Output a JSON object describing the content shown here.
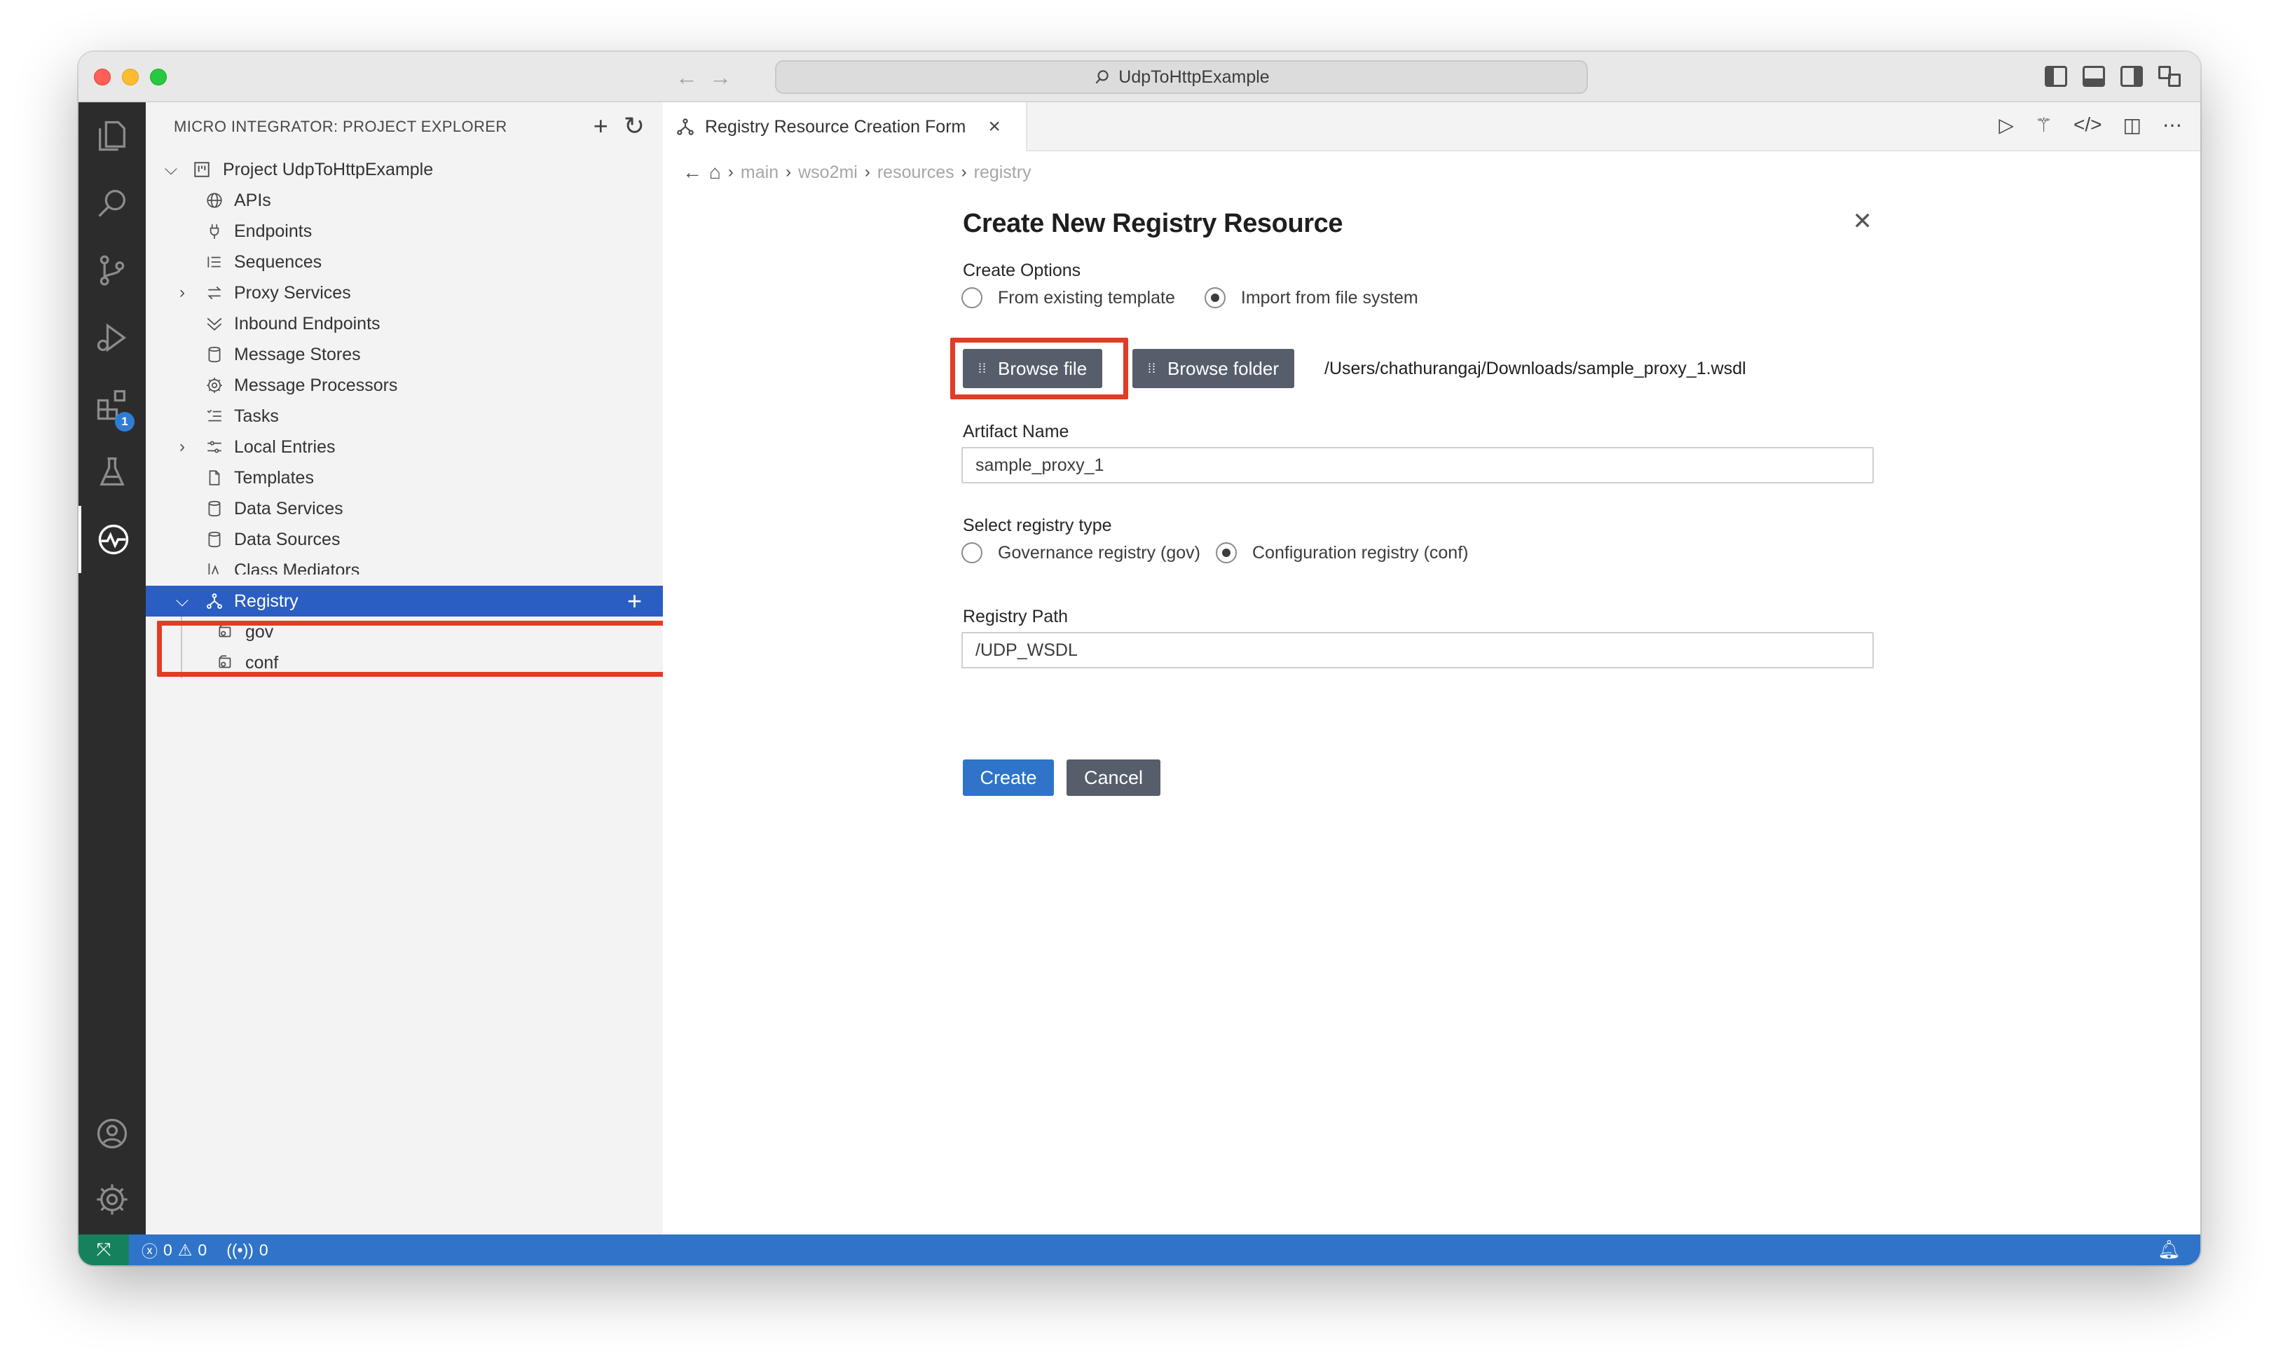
{
  "window": {
    "title": "UdpToHttpExample"
  },
  "sidebar": {
    "header": "MICRO INTEGRATOR: PROJECT EXPLORER",
    "project_label": "Project UdpToHttpExample",
    "items": [
      {
        "label": "APIs",
        "icon": "globe-icon"
      },
      {
        "label": "Endpoints",
        "icon": "plug-icon"
      },
      {
        "label": "Sequences",
        "icon": "list-icon"
      },
      {
        "label": "Proxy Services",
        "icon": "arrows-icon"
      },
      {
        "label": "Inbound Endpoints",
        "icon": "inbound-icon"
      },
      {
        "label": "Message Stores",
        "icon": "database-icon"
      },
      {
        "label": "Message Processors",
        "icon": "gear-icon"
      },
      {
        "label": "Tasks",
        "icon": "checklist-icon"
      },
      {
        "label": "Local Entries",
        "icon": "sliders-icon"
      },
      {
        "label": "Templates",
        "icon": "file-icon"
      },
      {
        "label": "Data Services",
        "icon": "database-icon"
      },
      {
        "label": "Data Sources",
        "icon": "database-icon"
      },
      {
        "label": "Class Mediators",
        "icon": "class-icon"
      }
    ],
    "registry": {
      "label": "Registry",
      "children": [
        "gov",
        "conf"
      ]
    }
  },
  "editor": {
    "tab_label": "Registry Resource Creation Form",
    "breadcrumb": [
      "main",
      "wso2mi",
      "resources",
      "registry"
    ]
  },
  "form": {
    "title": "Create New Registry Resource",
    "create_options_label": "Create Options",
    "option_template": "From existing template",
    "option_import": "Import from file system",
    "selected_create_option": "Import from file system",
    "browse_file": "Browse file",
    "browse_folder": "Browse folder",
    "selected_path": "/Users/chathurangaj/Downloads/sample_proxy_1.wsdl",
    "artifact_name_label": "Artifact Name",
    "artifact_name_value": "sample_proxy_1",
    "registry_type_label": "Select registry type",
    "registry_gov": "Governance registry (gov)",
    "registry_conf": "Configuration registry (conf)",
    "selected_registry_type": "Configuration registry (conf)",
    "registry_path_label": "Registry Path",
    "registry_path_value": "/UDP_WSDL",
    "create_button": "Create",
    "cancel_button": "Cancel"
  },
  "statusbar": {
    "errors": "0",
    "warnings": "0",
    "ports": "0"
  },
  "colors": {
    "accent": "#2f74c9",
    "selection": "#2a5ec2",
    "highlight_box": "#e23c25",
    "activity_bar": "#2c2c2c"
  }
}
